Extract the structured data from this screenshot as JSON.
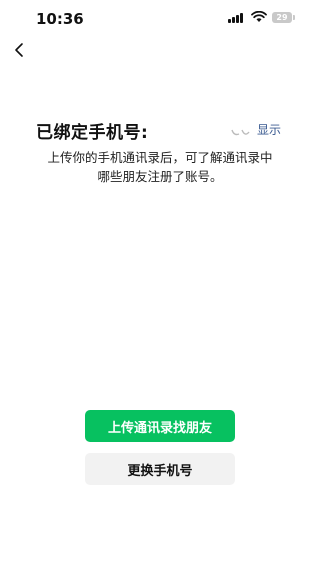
{
  "status_bar": {
    "time": "10:36",
    "battery": "29"
  },
  "header": {
    "back_icon": "chevron-left-icon"
  },
  "binding": {
    "title": "已绑定手机号:",
    "show_label": "显示"
  },
  "description": {
    "line1": "上传你的手机通讯录后，可了解通讯录中",
    "line2": "哪些朋友注册了账号。"
  },
  "actions": {
    "upload_label": "上传通讯录找朋友",
    "change_label": "更换手机号"
  },
  "colors": {
    "accent": "#07c160",
    "link": "#3b5b91"
  }
}
